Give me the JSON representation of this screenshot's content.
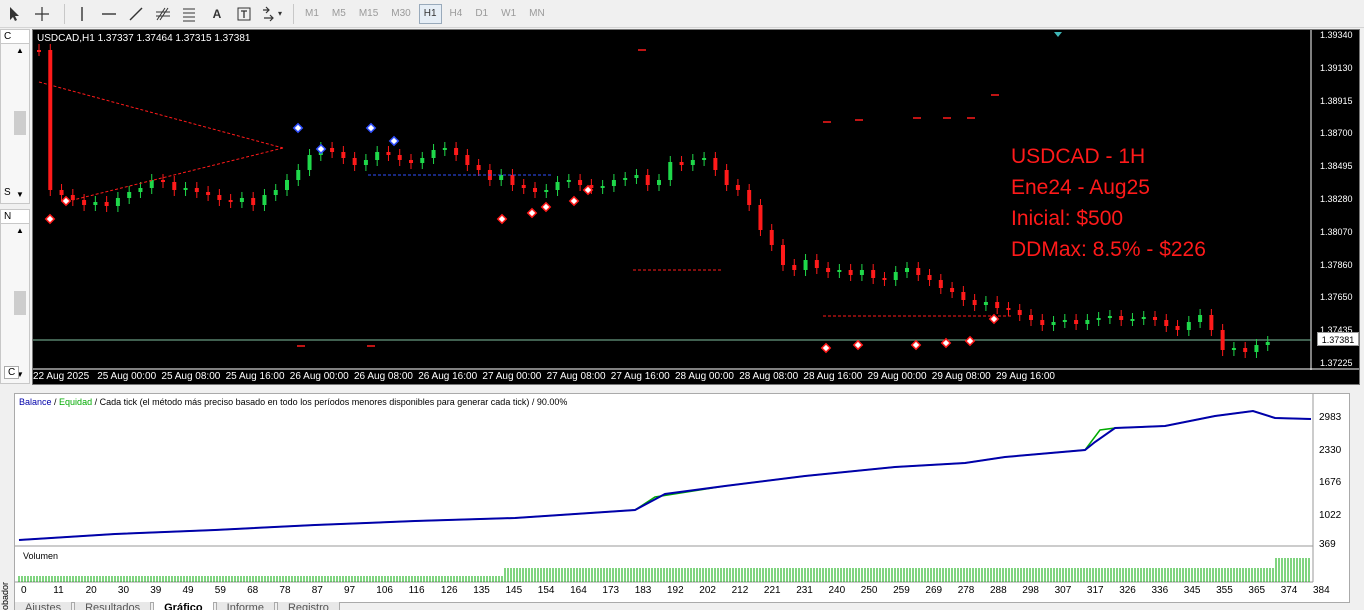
{
  "toolbar": {
    "tools": [
      "cursor-icon",
      "crosshair-icon",
      "vertical-line-icon",
      "horizontal-line-icon",
      "trendline-icon",
      "fibonacci-icon",
      "fibonacci-fan-icon",
      "text-icon",
      "text-label-icon",
      "arrows-icon"
    ],
    "text_tool_label": "A",
    "timeframes": [
      "M1",
      "M5",
      "M15",
      "M30",
      "H1",
      "H4",
      "D1",
      "W1",
      "MN"
    ],
    "active_timeframe": "H1"
  },
  "side_panels": {
    "top_head": "C",
    "top_marker": "S",
    "middle_head": "N",
    "bottom_head": "C"
  },
  "chart": {
    "header": "USDCAD,H1  1.37337 1.37464 1.37315 1.37381",
    "current_price": "1.37381",
    "info": [
      "USDCAD - 1H",
      "Ene24 - Aug25",
      "Inicial: $500",
      "DDMax: 8.5% - $226"
    ],
    "price_axis": [
      "1.39340",
      "1.39130",
      "1.38915",
      "1.38700",
      "1.38495",
      "1.38280",
      "1.38070",
      "1.37860",
      "1.37650",
      "1.37435",
      "1.37225"
    ],
    "time_axis": [
      "22 Aug 2025",
      "25 Aug 00:00",
      "25 Aug 08:00",
      "25 Aug 16:00",
      "26 Aug 00:00",
      "26 Aug 08:00",
      "26 Aug 16:00",
      "27 Aug 00:00",
      "27 Aug 08:00",
      "27 Aug 16:00",
      "28 Aug 00:00",
      "28 Aug 08:00",
      "28 Aug 16:00",
      "29 Aug 00:00",
      "29 Aug 08:00",
      "29 Aug 16:00"
    ],
    "colors": {
      "bull": "#1fd84a",
      "bear": "#ff1a1a",
      "background": "#000000",
      "grid": "#2a2a2a"
    }
  },
  "report": {
    "legend_balance": "Balance",
    "legend_sep": " / ",
    "legend_equity": "Equidad",
    "legend_rest": " / Cada tick (el método más preciso basado en todo los períodos menores disponibles para generar cada tick)  / 90.00%",
    "y_axis": [
      "2983",
      "2330",
      "1676",
      "1022",
      "369"
    ],
    "volume_label": "Volumen",
    "x_axis": [
      "0",
      "11",
      "20",
      "30",
      "39",
      "49",
      "59",
      "68",
      "78",
      "87",
      "97",
      "106",
      "116",
      "126",
      "135",
      "145",
      "154",
      "164",
      "173",
      "183",
      "192",
      "202",
      "212",
      "221",
      "231",
      "240",
      "250",
      "259",
      "269",
      "278",
      "288",
      "298",
      "307",
      "317",
      "326",
      "336",
      "345",
      "355",
      "365",
      "374",
      "384"
    ],
    "colors": {
      "balance": "#0000aa",
      "equity": "#00aa00",
      "volume": "#00aa00"
    }
  },
  "tabs": [
    "Ajustes",
    "Resultados",
    "Gráfico",
    "Informe",
    "Registro"
  ],
  "active_tab": "Gráfico",
  "vertical_label": "obador"
}
